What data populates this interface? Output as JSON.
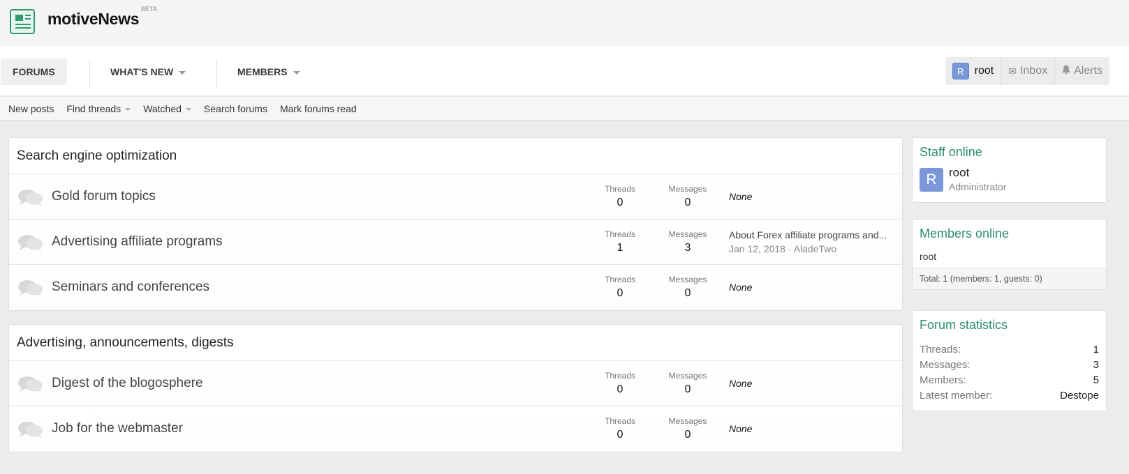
{
  "brand": {
    "name": "motiveNews",
    "badge": "BETA"
  },
  "nav": {
    "tabs": [
      {
        "label": "FORUMS"
      },
      {
        "label": "WHAT'S NEW"
      },
      {
        "label": "MEMBERS"
      }
    ],
    "user": {
      "avatar_letter": "R",
      "name": "root"
    },
    "inbox_label": "Inbox",
    "alerts_label": "Alerts"
  },
  "subnav": {
    "items": [
      {
        "label": "New posts"
      },
      {
        "label": "Find threads"
      },
      {
        "label": "Watched"
      },
      {
        "label": "Search forums"
      },
      {
        "label": "Mark forums read"
      }
    ]
  },
  "categories": [
    {
      "title": "Search engine optimization",
      "forums": [
        {
          "title": "Gold forum topics",
          "threads_label": "Threads",
          "threads": "0",
          "messages_label": "Messages",
          "messages": "0",
          "latest_none": "None"
        },
        {
          "title": "Advertising affiliate programs",
          "threads_label": "Threads",
          "threads": "1",
          "messages_label": "Messages",
          "messages": "3",
          "latest_title": "About Forex affiliate programs and...",
          "latest_meta": "Jan 12, 2018 · AladeTwo"
        },
        {
          "title": "Seminars and conferences",
          "threads_label": "Threads",
          "threads": "0",
          "messages_label": "Messages",
          "messages": "0",
          "latest_none": "None"
        }
      ]
    },
    {
      "title": "Advertising, announcements, digests",
      "forums": [
        {
          "title": "Digest of the blogosphere",
          "threads_label": "Threads",
          "threads": "0",
          "messages_label": "Messages",
          "messages": "0",
          "latest_none": "None"
        },
        {
          "title": "Job for the webmaster",
          "threads_label": "Threads",
          "threads": "0",
          "messages_label": "Messages",
          "messages": "0",
          "latest_none": "None"
        }
      ]
    }
  ],
  "sidebar": {
    "staff": {
      "title": "Staff online",
      "avatar_letter": "R",
      "name": "root",
      "role": "Administrator"
    },
    "members_online": {
      "title": "Members online",
      "name": "root",
      "total": "Total: 1 (members: 1, guests: 0)"
    },
    "stats": {
      "title": "Forum statistics",
      "rows": [
        {
          "key": "Threads:",
          "value": "1"
        },
        {
          "key": "Messages:",
          "value": "3"
        },
        {
          "key": "Members:",
          "value": "5"
        },
        {
          "key": "Latest member:",
          "value": "Destope"
        }
      ]
    }
  },
  "colors": {
    "accent": "#2c8f6a",
    "avatar": "#7a98d8"
  }
}
